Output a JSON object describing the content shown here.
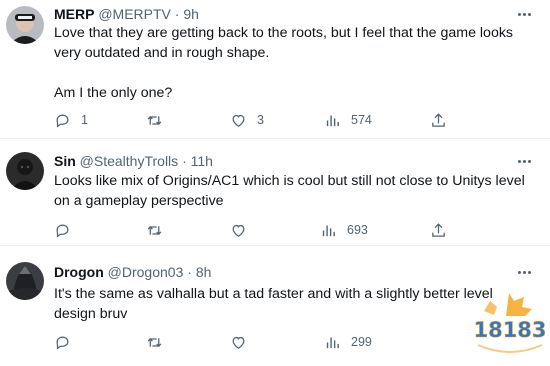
{
  "tweets": [
    {
      "name": "MERP",
      "handle": "@MERPTV",
      "separator": "·",
      "time": "9h",
      "text": [
        "Love that they are getting back to the roots, but I feel that the game looks very outdated and in rough shape.",
        "Am I the only one?"
      ],
      "replies": "1",
      "retweets": "",
      "likes": "3",
      "views": "574"
    },
    {
      "name": "Sin",
      "handle": "@StealthyTrolls",
      "separator": "·",
      "time": "11h",
      "text": [
        "Looks like mix of Origins/AC1 which is cool but still not close to Unitys level on a gameplay perspective"
      ],
      "replies": "",
      "retweets": "",
      "likes": "",
      "views": "693"
    },
    {
      "name": "Drogon",
      "handle": "@Drogon03",
      "separator": "·",
      "time": "8h",
      "text": [
        "It's the same as valhalla but a tad faster and with a slightly better level design bruv"
      ],
      "replies": "",
      "retweets": "",
      "likes": "",
      "views": "299"
    }
  ],
  "watermark": {
    "text": "18183"
  },
  "colors": {
    "muted": "#536471",
    "text": "#0f1419",
    "divider": "#eff3f4",
    "watermark_blue": "#2f78c9",
    "watermark_orange": "#f5a623"
  }
}
